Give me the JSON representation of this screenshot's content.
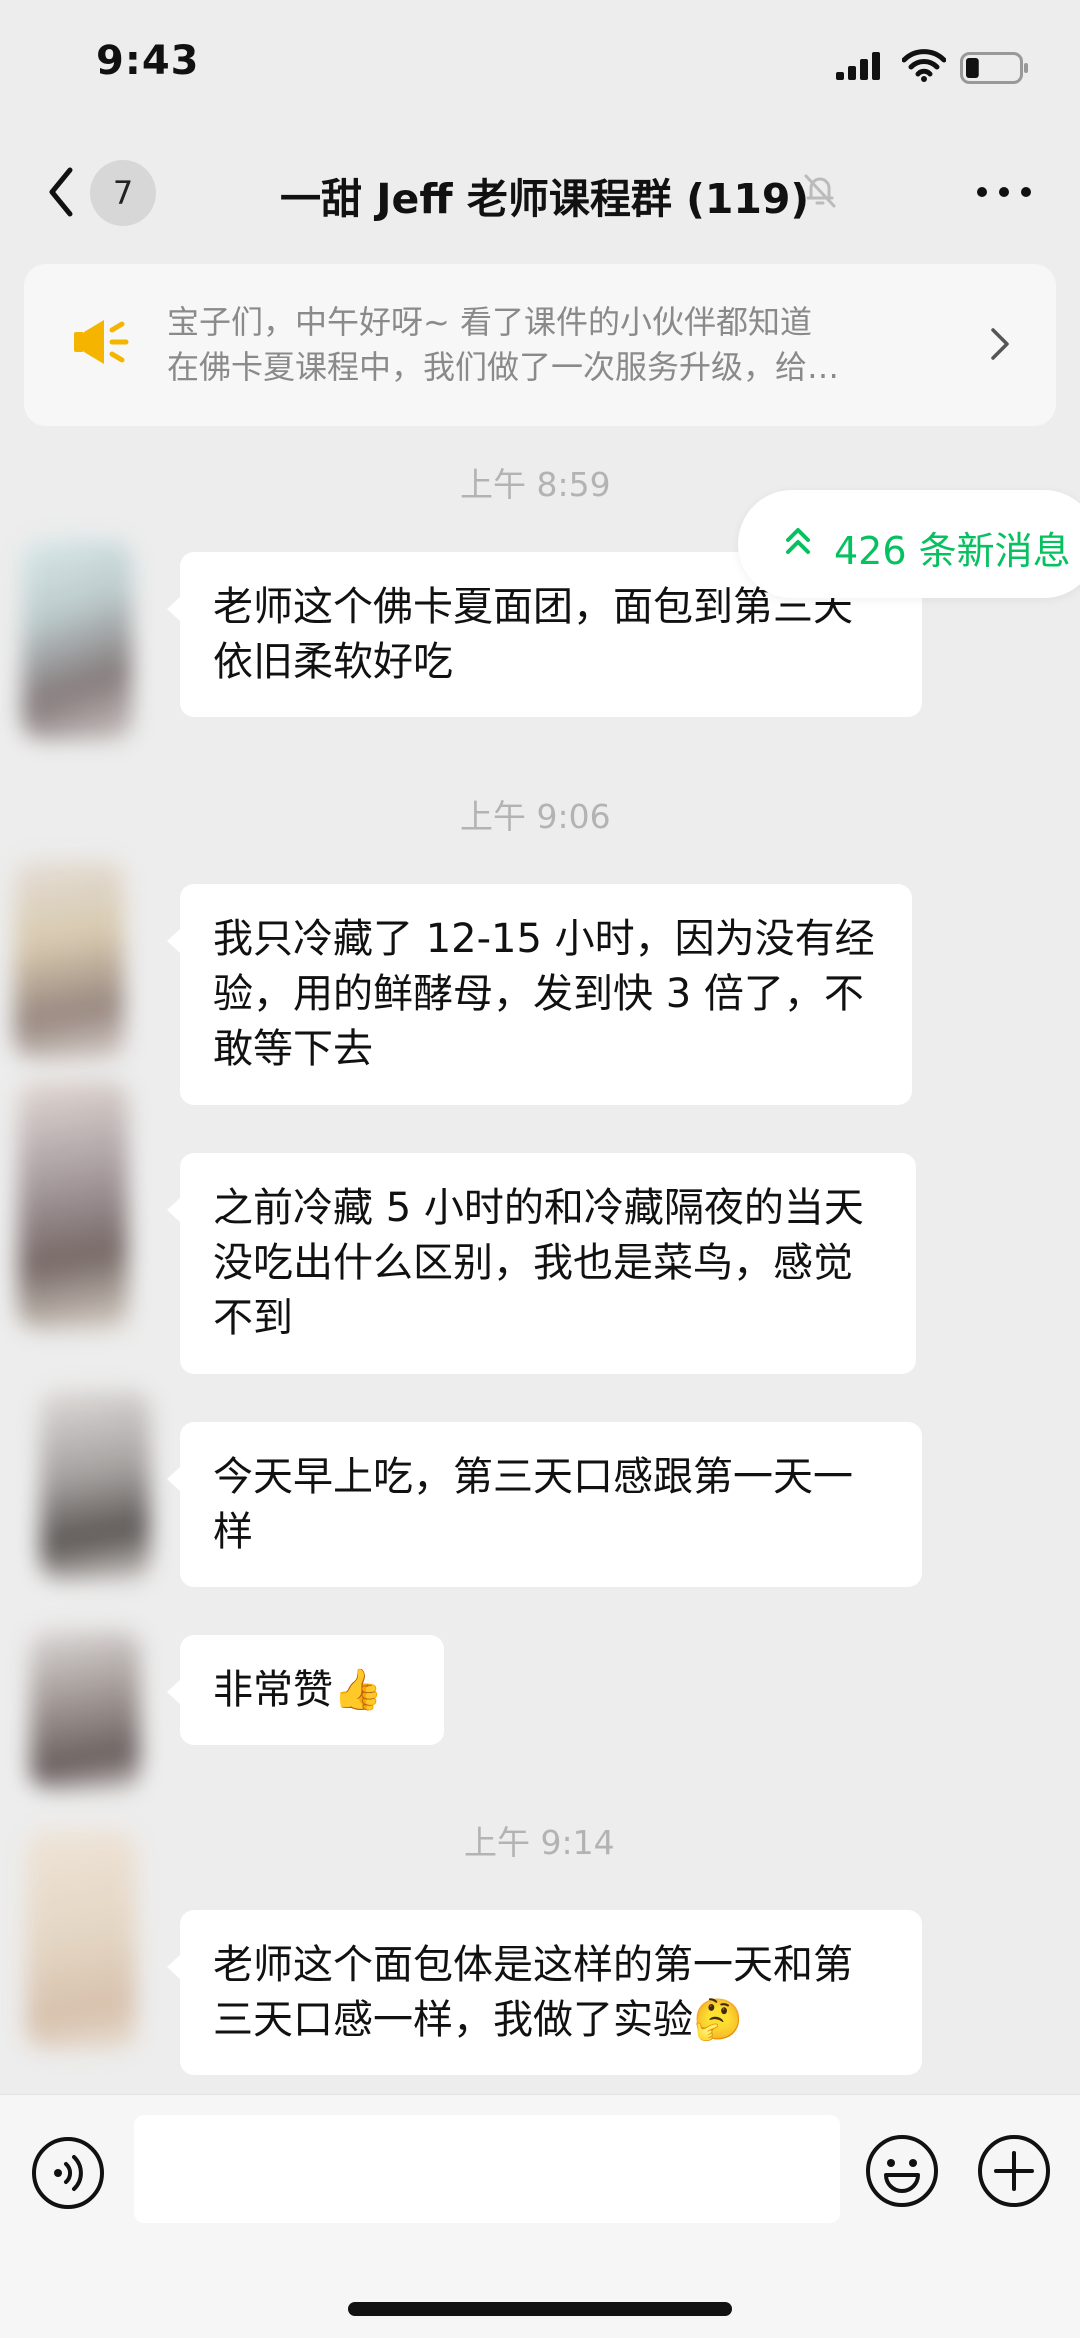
{
  "status_bar": {
    "time": "9:43",
    "battery_level": 0.25
  },
  "header": {
    "unread_count": "7",
    "title": "一甜 Jeff 老师课程群 (119)"
  },
  "announcement": {
    "line1": "宝子们，中午好呀~ 看了课件的小伙伴都知道",
    "line2": "在佛卡夏课程中，我们做了一次服务升级，给…"
  },
  "new_messages_label": "426 条新消息",
  "timestamps": [
    "上午 8:59",
    "上午 9:06",
    "上午 9:14"
  ],
  "messages": [
    {
      "text": "老师这个佛卡夏面团，面包到第三天依旧柔软好吃",
      "emoji": ""
    },
    {
      "text": "我只冷藏了 12-15 小时，因为没有经验，用的鲜酵母，发到快 3 倍了，不敢等下去",
      "emoji": ""
    },
    {
      "text": "之前冷藏 5 小时的和冷藏隔夜的当天没吃出什么区别，我也是菜鸟，感觉不到",
      "emoji": ""
    },
    {
      "text": "今天早上吃，第三天口感跟第一天一样",
      "emoji": ""
    },
    {
      "text": "非常赞",
      "emoji": "👍"
    },
    {
      "text": "老师这个面包体是这样的第一天和第三天口感一样，我做了实验",
      "emoji": "🤔"
    }
  ],
  "colors": {
    "accent_green": "#07c160",
    "background": "#ededed",
    "bubble": "#ffffff"
  },
  "icons": [
    "back-chevron-icon",
    "mute-bell-icon",
    "more-icon",
    "megaphone-icon",
    "chevron-right-icon",
    "double-chevron-up-icon",
    "voice-icon",
    "emoji-icon",
    "plus-icon"
  ]
}
